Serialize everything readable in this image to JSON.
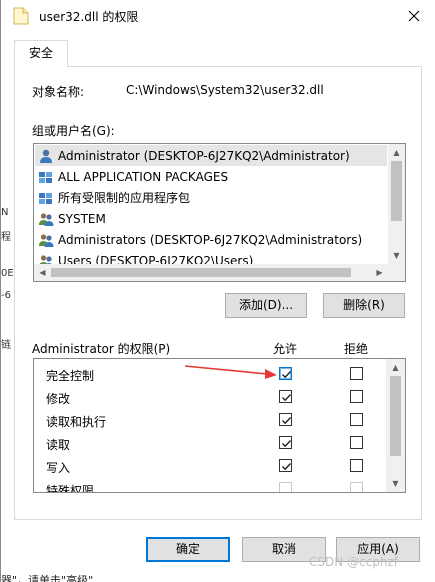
{
  "window": {
    "title": "user32.dll 的权限",
    "close_glyph": "✕"
  },
  "tabs": [
    {
      "label": "安全"
    }
  ],
  "object": {
    "label": "对象名称:",
    "value": "C:\\Windows\\System32\\user32.dll"
  },
  "groups": {
    "label": "组或用户名(G):",
    "items": [
      {
        "name": "Administrator (DESKTOP-6J27KQ2\\Administrator)",
        "icon": "user-icon",
        "selected": true
      },
      {
        "name": "ALL APPLICATION PACKAGES",
        "icon": "packages-icon",
        "selected": false
      },
      {
        "name": "所有受限制的应用程序包",
        "icon": "packages-icon",
        "selected": false
      },
      {
        "name": "SYSTEM",
        "icon": "group-icon",
        "selected": false
      },
      {
        "name": "Administrators (DESKTOP-6J27KQ2\\Administrators)",
        "icon": "group-icon",
        "selected": false
      },
      {
        "name": "Users (DESKTOP-6J27KQ2\\Users)",
        "icon": "group-icon",
        "selected": false
      }
    ]
  },
  "buttons": {
    "add": "添加(D)...",
    "remove": "删除(R)",
    "ok": "确定",
    "cancel": "取消",
    "apply": "应用(A)"
  },
  "permissions": {
    "header": "Administrator 的权限(P)",
    "allow_header": "允许",
    "deny_header": "拒绝",
    "rows": [
      {
        "name": "完全控制",
        "allow": true,
        "deny": false,
        "highlight": true
      },
      {
        "name": "修改",
        "allow": true,
        "deny": false
      },
      {
        "name": "读取和执行",
        "allow": true,
        "deny": false
      },
      {
        "name": "读取",
        "allow": true,
        "deny": false
      },
      {
        "name": "写入",
        "allow": true,
        "deny": false
      },
      {
        "name": "特殊权限",
        "allow": false,
        "deny": false
      }
    ]
  },
  "annotation": {
    "color": "#e53935"
  },
  "background_fragments": {
    "bottom_text": "器\"，请单击\"高级\"",
    "left_chars": [
      "N",
      "程",
      "0E",
      "-6",
      "链"
    ]
  },
  "watermark": "CSDN @ccphzf",
  "colors": {
    "accent": "#0078d7",
    "selection": "#e5e5e5"
  }
}
